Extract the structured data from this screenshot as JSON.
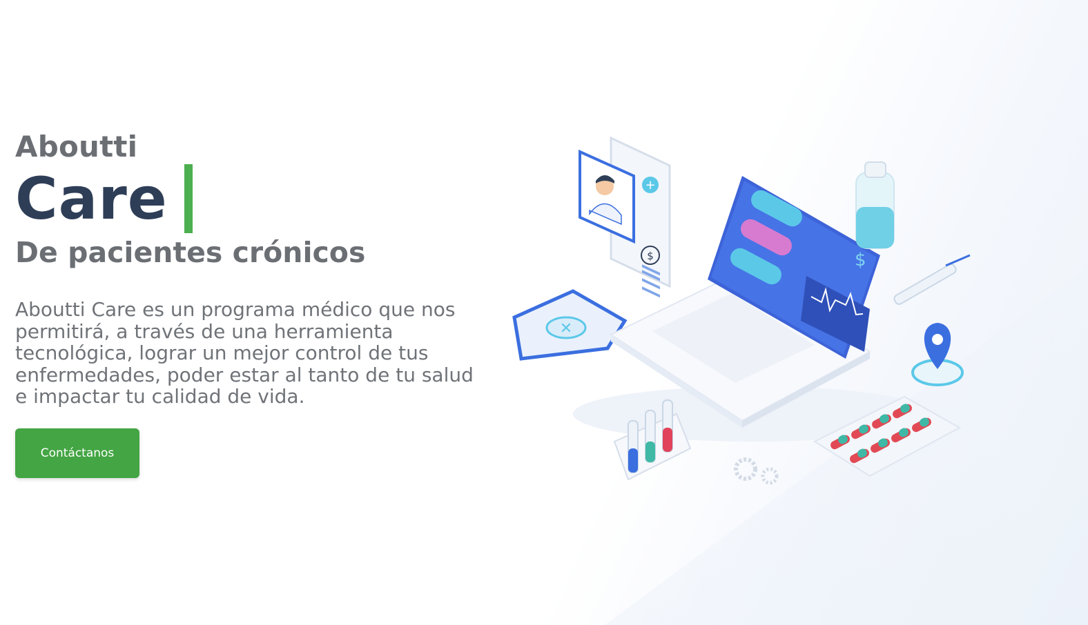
{
  "hero": {
    "brand_small": "Aboutti",
    "brand_big": "Care",
    "subtitle": "De pacientes crónicos",
    "description": "Aboutti Care es un programa médico que nos permitirá, a través de una herramienta tecnológica, lograr un mejor control de tus enfermedades, poder estar al tanto de tu salud e impactar tu calidad de vida.",
    "cta_label": "Contáctanos"
  },
  "illustration": {
    "laptop_currency_symbol": "$",
    "doctor_card_currency_symbol": "$"
  },
  "colors": {
    "brand_dark": "#2f3e57",
    "accent_green": "#4caf50",
    "button_green": "#43a543",
    "primary_blue": "#3b6fe0",
    "text_gray": "#6b6f74"
  }
}
